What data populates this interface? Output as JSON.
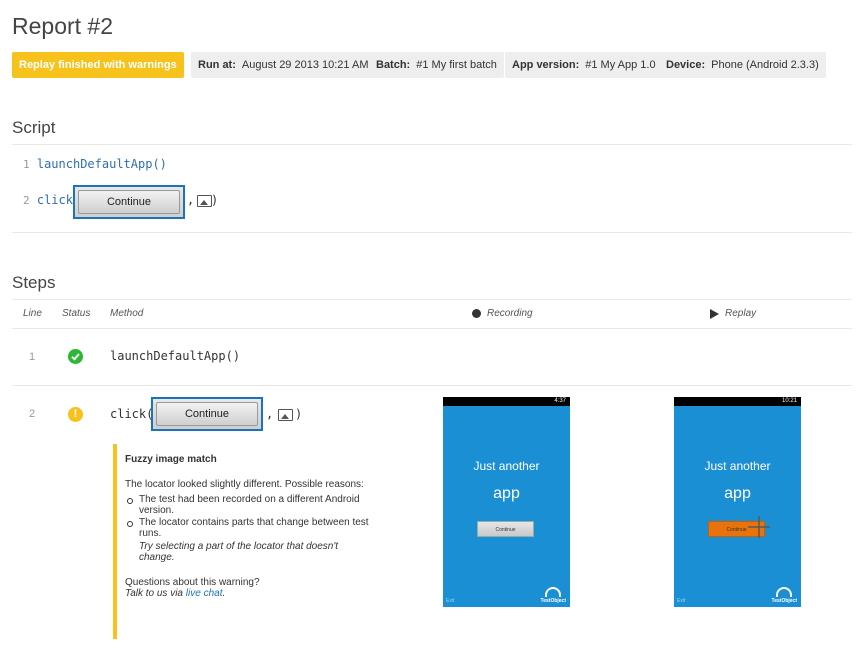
{
  "title": "Report #2",
  "badges": {
    "status": "Replay finished with warnings",
    "run_at_label": "Run at:",
    "run_at_value": "August 29 2013 10:21 AM",
    "batch_label": "Batch:",
    "batch_value": "#1 My first batch",
    "app_label": "App version:",
    "app_value": "#1 My App 1.0",
    "device_label": "Device:",
    "device_value": "Phone (Android 2.3.3)"
  },
  "script": {
    "heading": "Script",
    "lines": [
      {
        "no": "1",
        "code": "launchDefaultApp()"
      },
      {
        "no": "2",
        "prefix": "click(",
        "locator_label": "Continue",
        "sep": ",",
        "close": ")"
      }
    ]
  },
  "steps": {
    "heading": "Steps",
    "headers": {
      "line": "Line",
      "status": "Status",
      "method": "Method",
      "recording": "Recording",
      "replay": "Replay"
    },
    "rows": [
      {
        "line": "1",
        "status": "success",
        "method": "launchDefaultApp()"
      },
      {
        "line": "2",
        "status": "warning",
        "method_prefix": "click(",
        "locator_label": "Continue",
        "sep": ",",
        "close": ")"
      }
    ],
    "warning": {
      "title": "Fuzzy image match",
      "intro": "The locator looked slightly different. Possible reasons:",
      "reasons": [
        "The test had been recorded on a different Android version.",
        "The locator contains parts that change between test runs."
      ],
      "tip": "Try selecting a part of the locator that doesn't change.",
      "question": "Questions about this warning?",
      "talk_prefix": "Talk to us via ",
      "link": "live chat",
      "talk_suffix": "."
    },
    "recording_screen": {
      "time": "4:37",
      "line1": "Just another",
      "line2": "app",
      "button": "Continue",
      "exit": "Exit",
      "logo": "TestObject"
    },
    "replay_screen": {
      "time": "10:21",
      "line1": "Just another",
      "line2": "app",
      "button": "Continue",
      "exit": "Exit",
      "logo": "TestObject"
    }
  },
  "colors": {
    "warning": "#f7c21b",
    "success": "#2bb934",
    "accent": "#1a74b8",
    "screen": "#1b8fd4",
    "replay_button": "#e8730c"
  }
}
